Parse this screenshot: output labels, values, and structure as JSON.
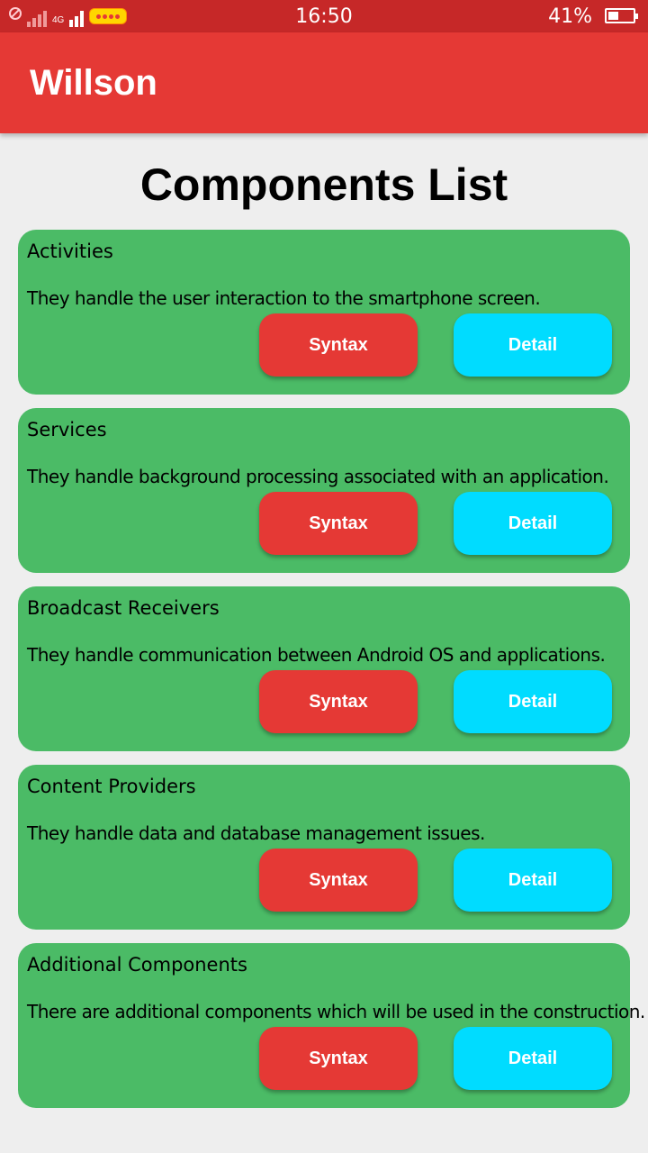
{
  "status_bar": {
    "network": "4G",
    "time": "16:50",
    "battery_percent": "41%",
    "battery_level": 0.41,
    "icons": [
      "no-sim-icon",
      "signal-icon",
      "carrier-logo-icon",
      "battery-icon"
    ]
  },
  "app_bar": {
    "title": "Willson"
  },
  "page": {
    "title": "Components List"
  },
  "colors": {
    "status_bar": "#c62828",
    "app_bar": "#e53935",
    "card": "#4bbb66",
    "syntax_button": "#e53935",
    "detail_button": "#00dcff",
    "background": "#eeeeee"
  },
  "components": [
    {
      "name": "Activities",
      "description": "They handle the user interaction to the smartphone screen.",
      "syntax_label": "Syntax",
      "detail_label": "Detail"
    },
    {
      "name": "Services",
      "description": "They handle background processing associated with an application.",
      "syntax_label": "Syntax",
      "detail_label": "Detail"
    },
    {
      "name": "Broadcast Receivers",
      "description": "They handle communication between Android OS and applications.",
      "syntax_label": "Syntax",
      "detail_label": "Detail"
    },
    {
      "name": "Content Providers",
      "description": "They handle data and database management issues.",
      "syntax_label": "Syntax",
      "detail_label": "Detail"
    },
    {
      "name": "Additional Components",
      "description": "There are additional components which will be used in the construction.",
      "syntax_label": "Syntax",
      "detail_label": "Detail"
    }
  ]
}
